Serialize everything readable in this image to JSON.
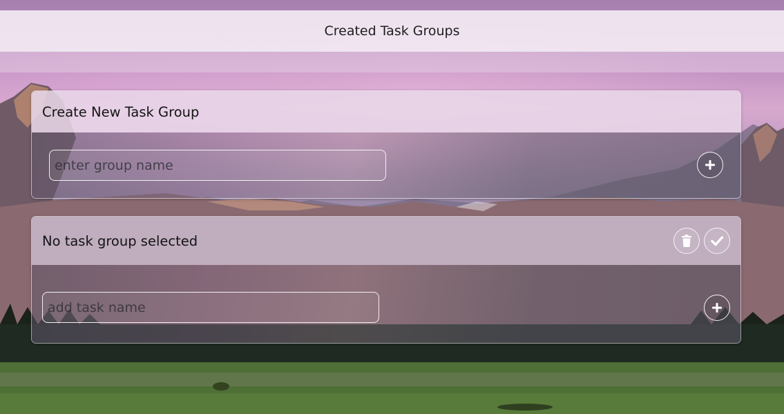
{
  "header": {
    "title": "Created Task Groups"
  },
  "create_group": {
    "title": "Create New Task Group",
    "group_name_placeholder": "enter group name",
    "add_icon": "plus-circle-icon"
  },
  "task_group": {
    "title": "No task group selected",
    "delete_icon": "trash-icon",
    "complete_icon": "check-icon",
    "task_name_placeholder": "add task name",
    "add_icon": "plus-circle-icon"
  },
  "colors": {
    "header_bg": "#F4ECF4",
    "card_header_bg": "#E8D6E8",
    "input_border": "#F2F2F2",
    "button_border": "#F4F4F4"
  }
}
